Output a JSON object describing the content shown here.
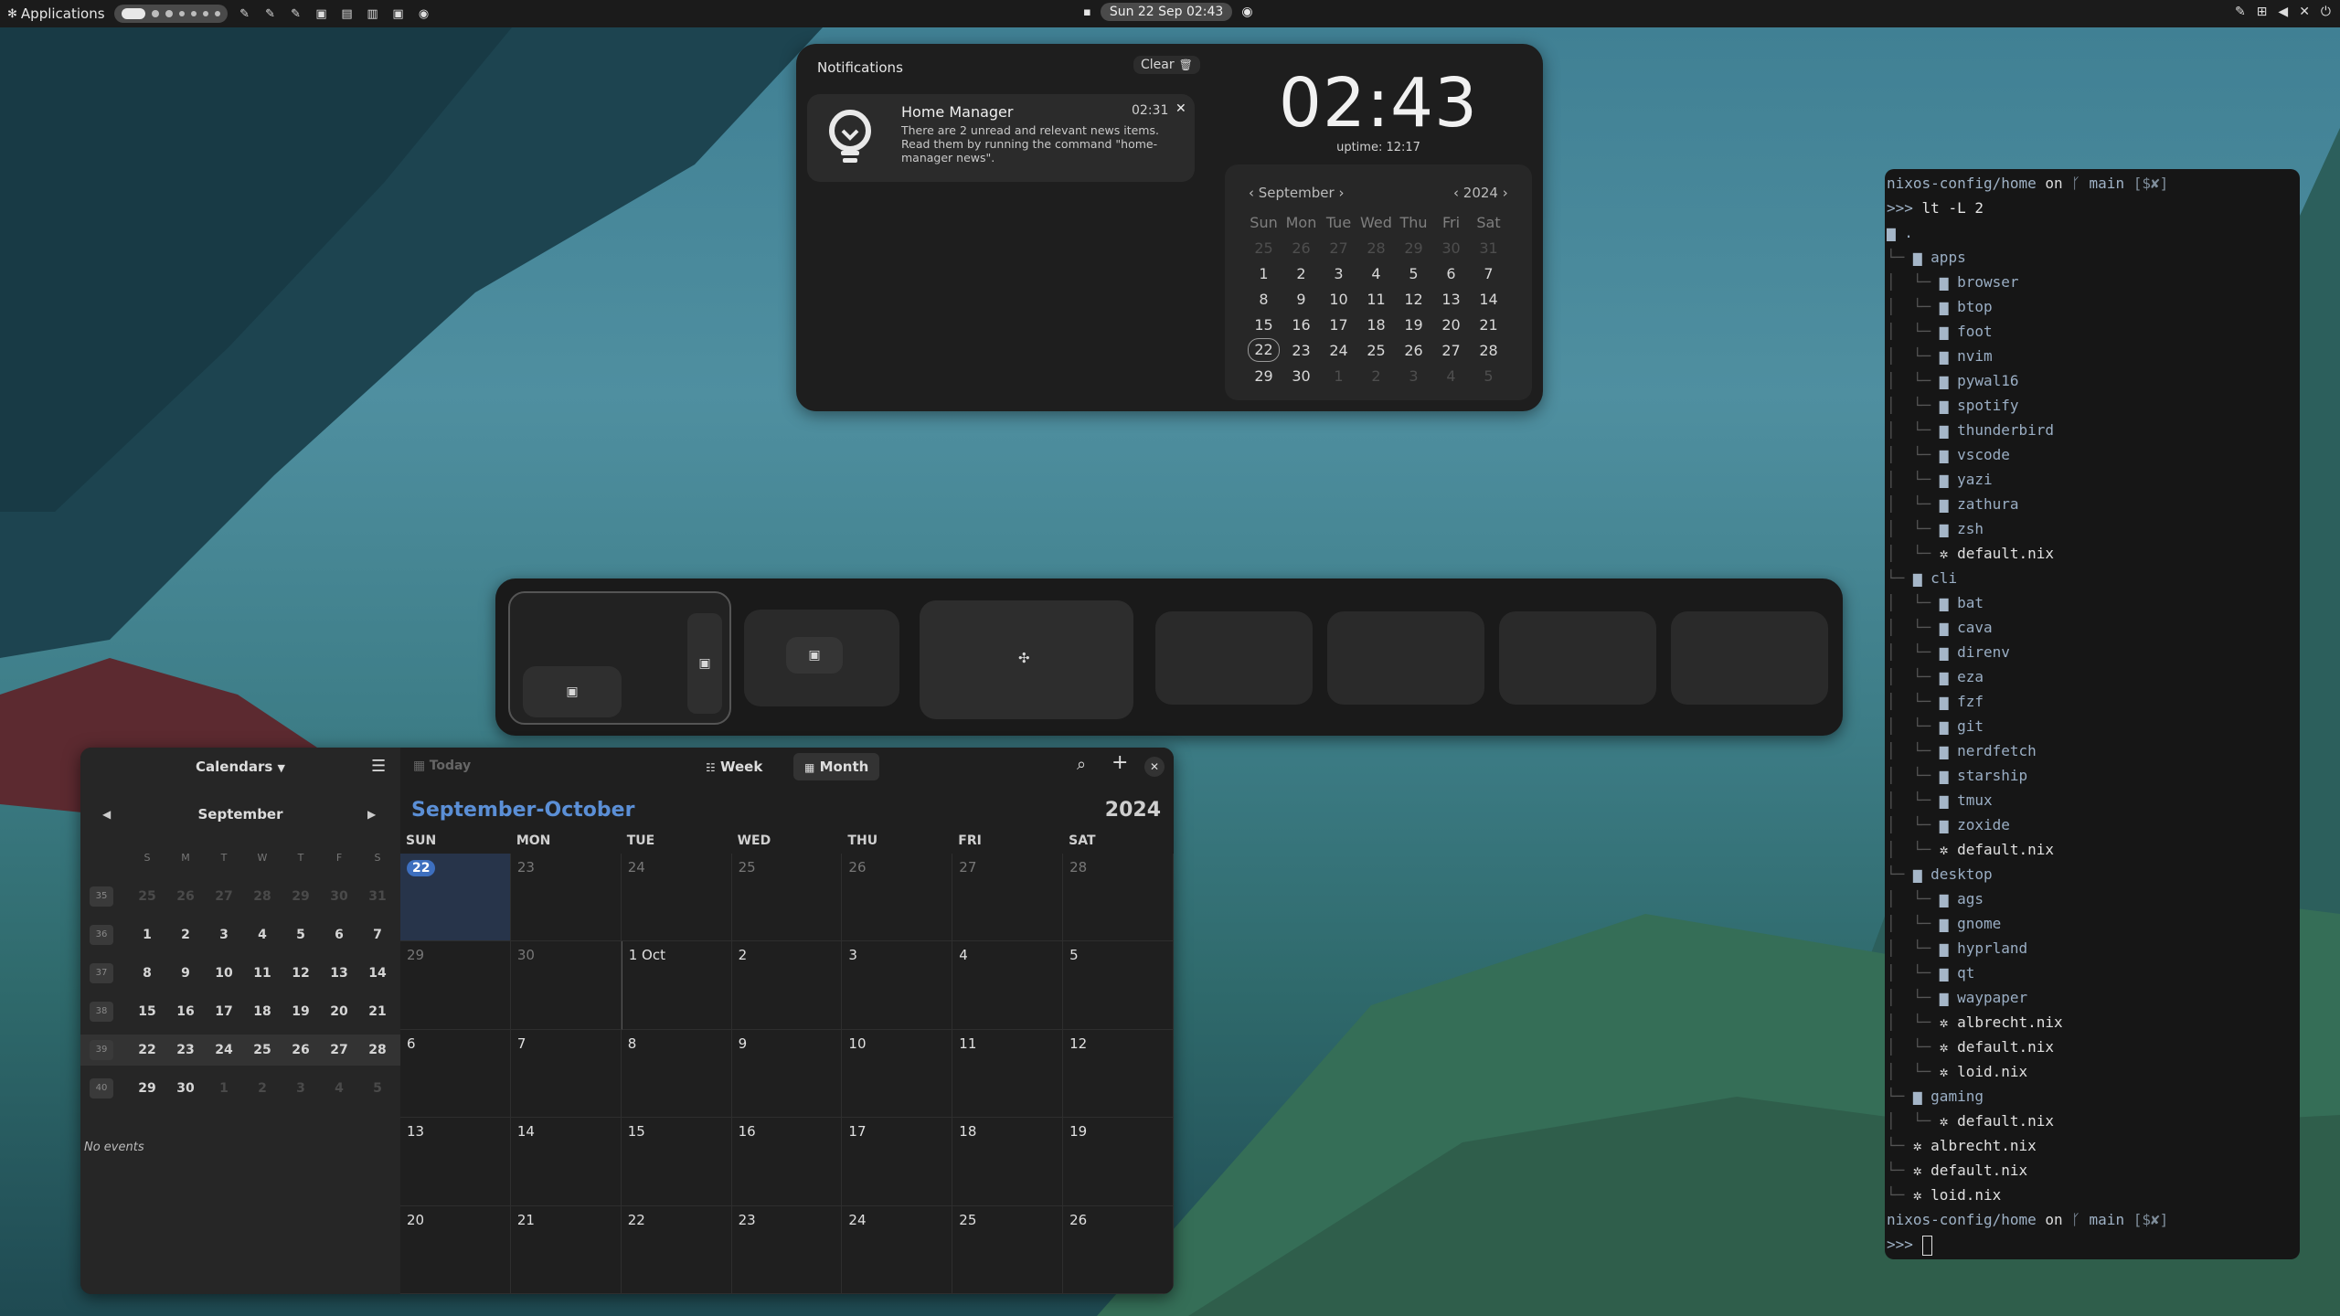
{
  "topbar": {
    "apps_label": "Applications",
    "datetime": "Sun 22 Sep  02:43"
  },
  "notifications": {
    "title": "Notifications",
    "clear_label": "Clear",
    "items": [
      {
        "app": "Home Manager",
        "time": "02:31",
        "body_lines": [
          "There are 2 unread and relevant news items.",
          "Read them by running the command \"home-",
          "manager news\"."
        ]
      }
    ]
  },
  "clock": {
    "time": "02:43",
    "uptime": "uptime: 12:17"
  },
  "mini_calendar": {
    "month": "September",
    "year": "2024",
    "weekdays": [
      "Sun",
      "Mon",
      "Tue",
      "Wed",
      "Thu",
      "Fri",
      "Sat"
    ],
    "days": [
      [
        "25",
        "26",
        "27",
        "28",
        "29",
        "30",
        "31"
      ],
      [
        "1",
        "2",
        "3",
        "4",
        "5",
        "6",
        "7"
      ],
      [
        "8",
        "9",
        "10",
        "11",
        "12",
        "13",
        "14"
      ],
      [
        "15",
        "16",
        "17",
        "18",
        "19",
        "20",
        "21"
      ],
      [
        "22",
        "23",
        "24",
        "25",
        "26",
        "27",
        "28"
      ],
      [
        "29",
        "30",
        "1",
        "2",
        "3",
        "4",
        "5"
      ]
    ],
    "selected": "22"
  },
  "calendar_app": {
    "calendars_label": "Calendars",
    "today_label": "Today",
    "week_label": "Week",
    "month_label": "Month",
    "sidebar_month": "September",
    "sidebar_weekdays": [
      "S",
      "M",
      "T",
      "W",
      "T",
      "F",
      "S"
    ],
    "sidebar_weeks": [
      {
        "num": "35",
        "days": [
          "25",
          "26",
          "27",
          "28",
          "29",
          "30",
          "31"
        ]
      },
      {
        "num": "36",
        "days": [
          "1",
          "2",
          "3",
          "4",
          "5",
          "6",
          "7"
        ]
      },
      {
        "num": "37",
        "days": [
          "8",
          "9",
          "10",
          "11",
          "12",
          "13",
          "14"
        ]
      },
      {
        "num": "38",
        "days": [
          "15",
          "16",
          "17",
          "18",
          "19",
          "20",
          "21"
        ]
      },
      {
        "num": "39",
        "days": [
          "22",
          "23",
          "24",
          "25",
          "26",
          "27",
          "28"
        ]
      },
      {
        "num": "40",
        "days": [
          "29",
          "30",
          "1",
          "2",
          "3",
          "4",
          "5"
        ]
      }
    ],
    "no_events": "No events",
    "range_title": "September-October",
    "year": "2024",
    "columns": [
      "SUN",
      "MON",
      "TUE",
      "WED",
      "THU",
      "FRI",
      "SAT"
    ],
    "weeks": [
      [
        "22",
        "23",
        "24",
        "25",
        "26",
        "27",
        "28"
      ],
      [
        "29",
        "30",
        "1 Oct",
        "2",
        "3",
        "4",
        "5"
      ],
      [
        "6",
        "7",
        "8",
        "9",
        "10",
        "11",
        "12"
      ],
      [
        "13",
        "14",
        "15",
        "16",
        "17",
        "18",
        "19"
      ],
      [
        "20",
        "21",
        "22",
        "23",
        "24",
        "25",
        "26"
      ]
    ]
  },
  "terminal": {
    "prompt_path": "nixos-config/home",
    "prompt_on": "on",
    "prompt_branch": "ᚴ main",
    "prompt_status": "[$✘]",
    "prompt_arrow": ">>>",
    "command": "lt -L 2",
    "tree": [
      {
        "depth": 0,
        "type": "folder",
        "name": "."
      },
      {
        "depth": 1,
        "type": "folder",
        "name": "apps"
      },
      {
        "depth": 2,
        "type": "folder",
        "name": "browser"
      },
      {
        "depth": 2,
        "type": "folder",
        "name": "btop"
      },
      {
        "depth": 2,
        "type": "folder",
        "name": "foot"
      },
      {
        "depth": 2,
        "type": "folder",
        "name": "nvim"
      },
      {
        "depth": 2,
        "type": "folder",
        "name": "pywal16"
      },
      {
        "depth": 2,
        "type": "folder",
        "name": "spotify"
      },
      {
        "depth": 2,
        "type": "folder",
        "name": "thunderbird"
      },
      {
        "depth": 2,
        "type": "folder",
        "name": "vscode"
      },
      {
        "depth": 2,
        "type": "folder",
        "name": "yazi"
      },
      {
        "depth": 2,
        "type": "folder",
        "name": "zathura"
      },
      {
        "depth": 2,
        "type": "folder",
        "name": "zsh"
      },
      {
        "depth": 2,
        "type": "file",
        "name": "default.nix"
      },
      {
        "depth": 1,
        "type": "folder",
        "name": "cli"
      },
      {
        "depth": 2,
        "type": "folder",
        "name": "bat"
      },
      {
        "depth": 2,
        "type": "folder",
        "name": "cava"
      },
      {
        "depth": 2,
        "type": "folder",
        "name": "direnv"
      },
      {
        "depth": 2,
        "type": "folder",
        "name": "eza"
      },
      {
        "depth": 2,
        "type": "folder",
        "name": "fzf"
      },
      {
        "depth": 2,
        "type": "folder",
        "name": "git"
      },
      {
        "depth": 2,
        "type": "folder",
        "name": "nerdfetch"
      },
      {
        "depth": 2,
        "type": "folder",
        "name": "starship"
      },
      {
        "depth": 2,
        "type": "folder",
        "name": "tmux"
      },
      {
        "depth": 2,
        "type": "folder",
        "name": "zoxide"
      },
      {
        "depth": 2,
        "type": "file",
        "name": "default.nix"
      },
      {
        "depth": 1,
        "type": "folder",
        "name": "desktop"
      },
      {
        "depth": 2,
        "type": "folder",
        "name": "ags"
      },
      {
        "depth": 2,
        "type": "folder",
        "name": "gnome"
      },
      {
        "depth": 2,
        "type": "folder",
        "name": "hyprland"
      },
      {
        "depth": 2,
        "type": "folder",
        "name": "qt"
      },
      {
        "depth": 2,
        "type": "folder",
        "name": "waypaper"
      },
      {
        "depth": 2,
        "type": "file",
        "name": "albrecht.nix"
      },
      {
        "depth": 2,
        "type": "file",
        "name": "default.nix"
      },
      {
        "depth": 2,
        "type": "file",
        "name": "loid.nix"
      },
      {
        "depth": 1,
        "type": "folder",
        "name": "gaming"
      },
      {
        "depth": 2,
        "type": "file",
        "name": "default.nix"
      },
      {
        "depth": 1,
        "type": "file",
        "name": "albrecht.nix"
      },
      {
        "depth": 1,
        "type": "file",
        "name": "default.nix"
      },
      {
        "depth": 1,
        "type": "file",
        "name": "loid.nix"
      }
    ]
  },
  "colors": {
    "accent": "#5b8fd6",
    "today_badge": "#3d6fbf",
    "panel": "#1e1e1e"
  }
}
